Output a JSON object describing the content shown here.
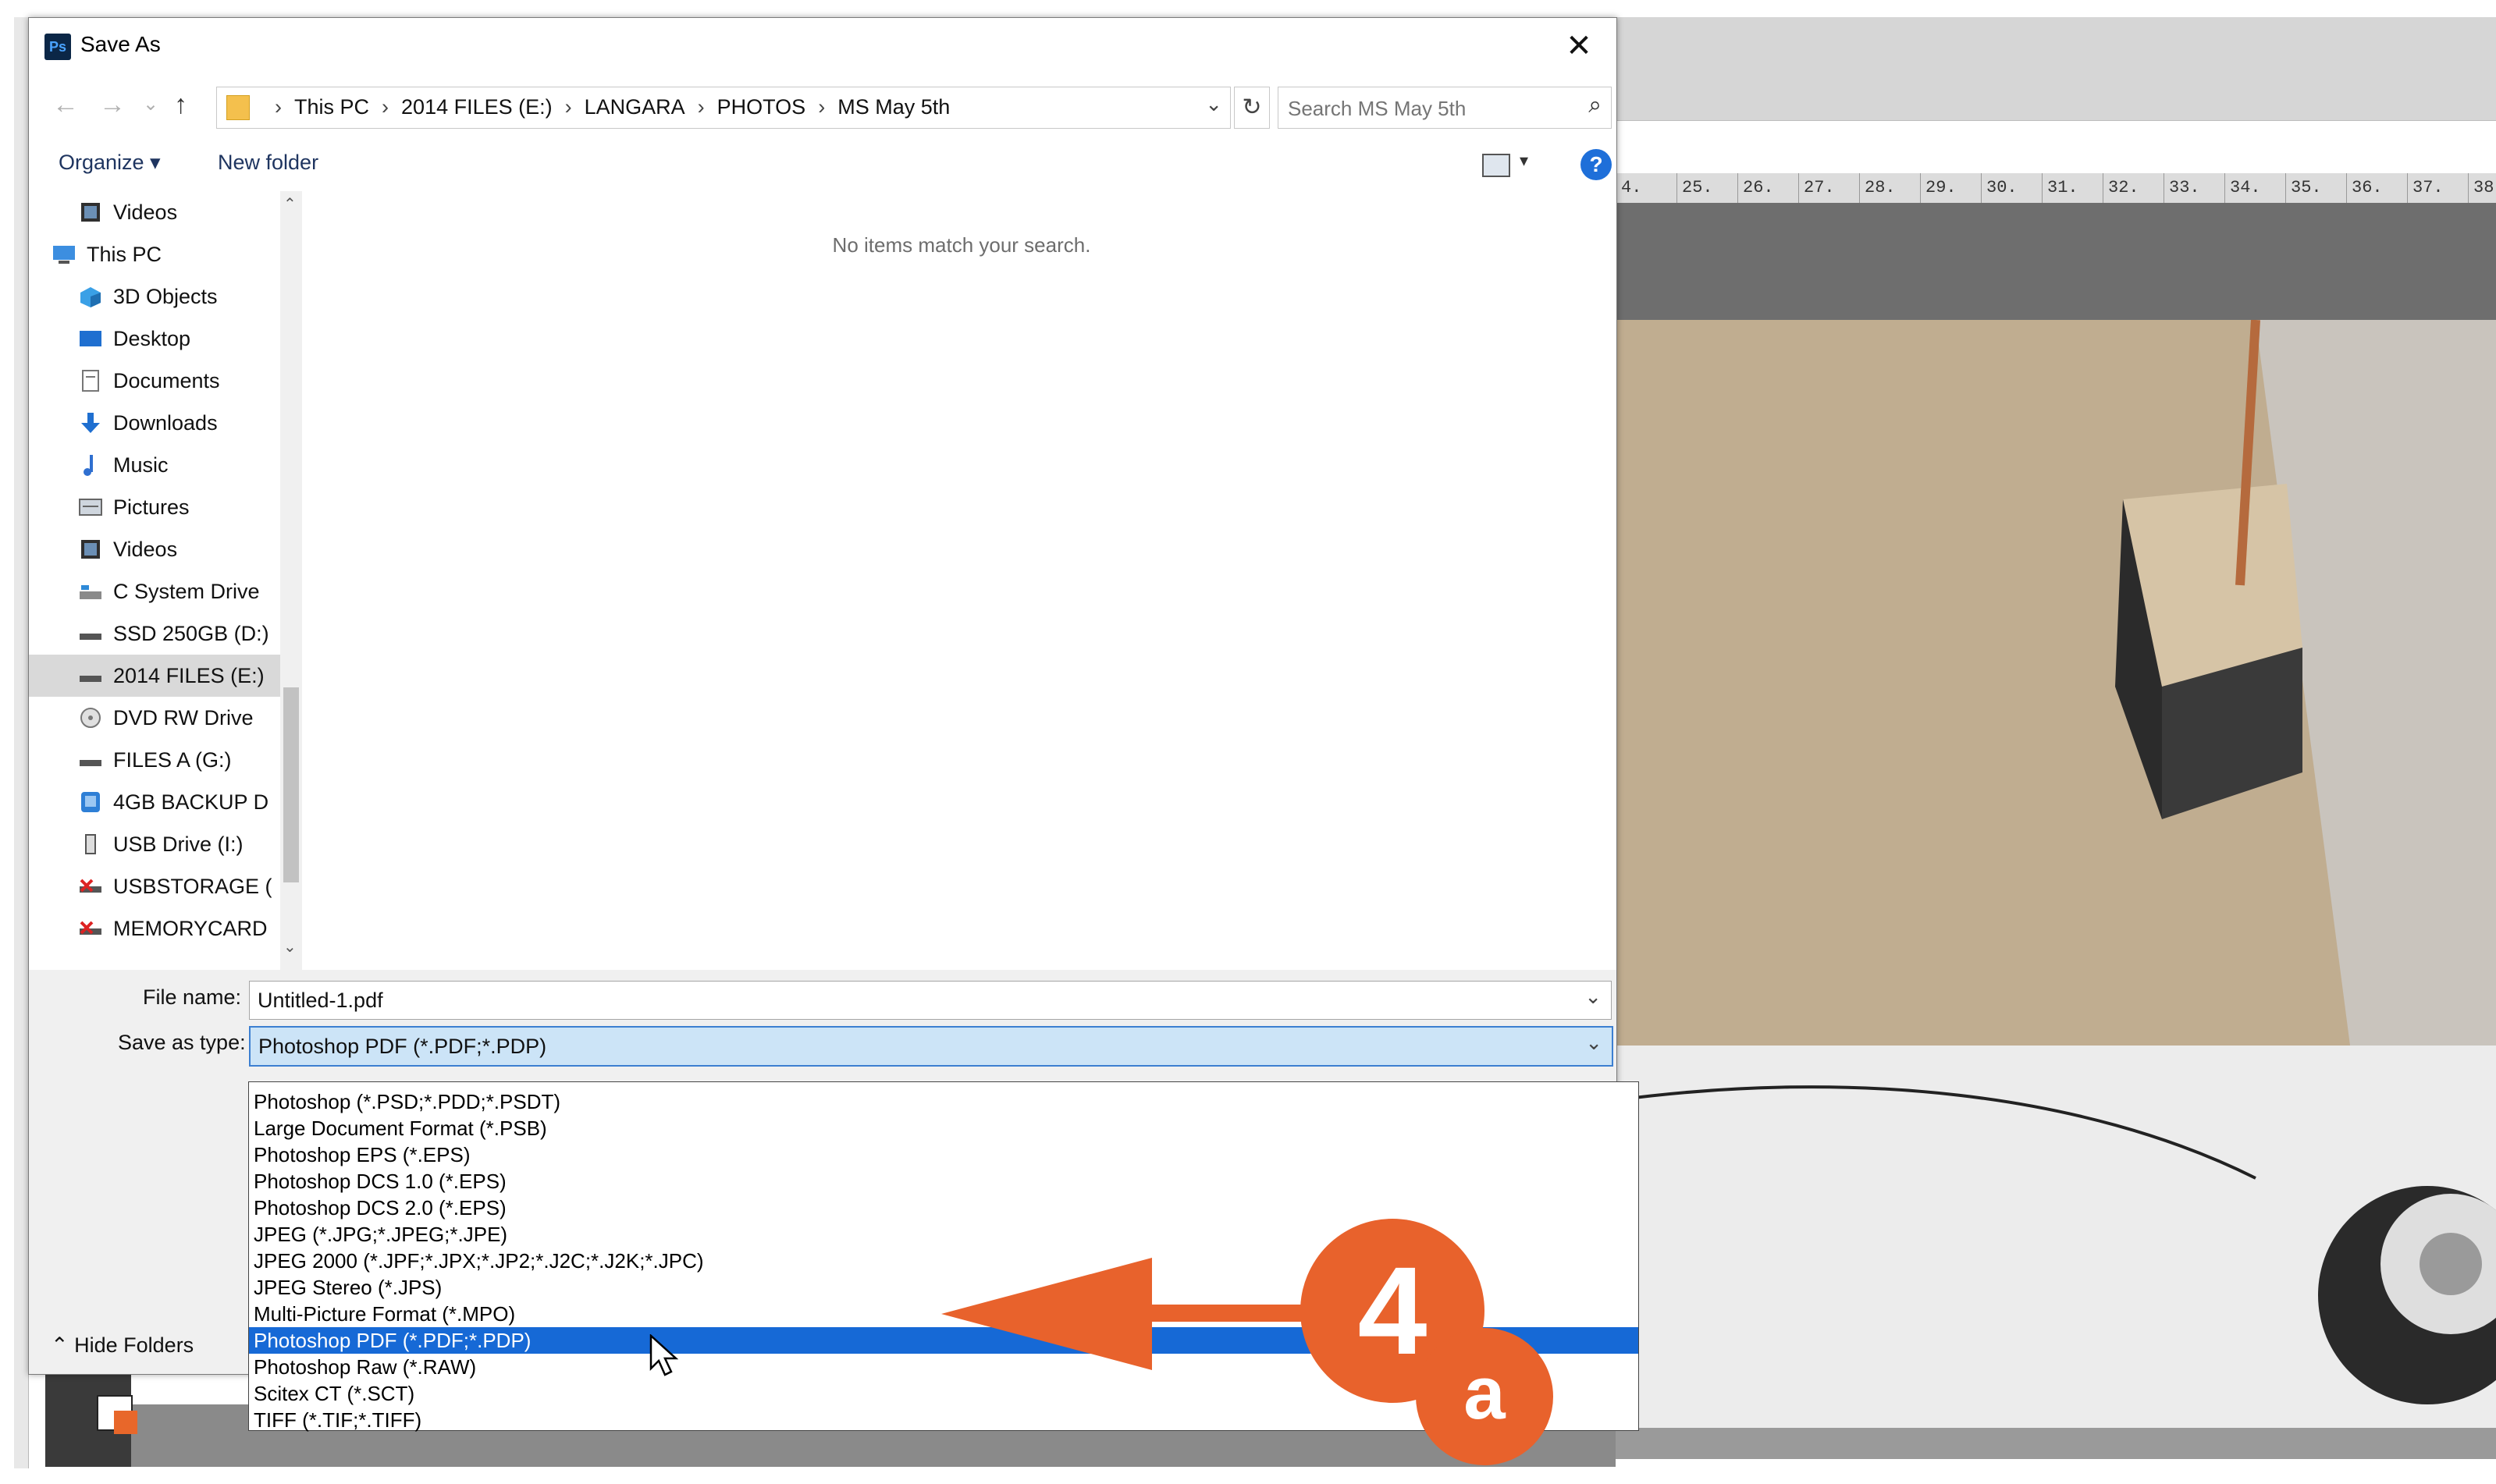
{
  "dialog": {
    "title": "Save As",
    "app_icon": "Ps",
    "close_glyph": "✕"
  },
  "nav": {
    "back_glyph": "←",
    "forward_glyph": "→",
    "recent_glyph": "⌄",
    "up_glyph": "↑",
    "breadcrumbs": [
      "This PC",
      "2014 FILES (E:)",
      "LANGARA",
      "PHOTOS",
      "MS May 5th"
    ],
    "separator": "›",
    "dropdown_glyph": "⌄",
    "refresh_glyph": "↻",
    "search_placeholder": "Search MS May 5th",
    "search_glyph": "⌕"
  },
  "commands": {
    "organize": "Organize ▾",
    "new_folder": "New folder",
    "view_dropdown": "▾",
    "help": "?"
  },
  "navpane": {
    "scroll_up": "⌃",
    "scroll_down": "⌄",
    "items": [
      {
        "label": "Videos",
        "icon": "video-icon"
      },
      {
        "label": "This PC",
        "icon": "computer-icon"
      },
      {
        "label": "3D Objects",
        "icon": "cube-icon"
      },
      {
        "label": "Desktop",
        "icon": "desktop-icon"
      },
      {
        "label": "Documents",
        "icon": "document-icon"
      },
      {
        "label": "Downloads",
        "icon": "download-icon"
      },
      {
        "label": "Music",
        "icon": "music-icon"
      },
      {
        "label": "Pictures",
        "icon": "picture-icon"
      },
      {
        "label": "Videos",
        "icon": "video-icon"
      },
      {
        "label": "C System Drive",
        "icon": "system-drive-icon"
      },
      {
        "label": "SSD 250GB (D:)",
        "icon": "drive-icon"
      },
      {
        "label": "2014 FILES (E:)",
        "icon": "drive-icon",
        "selected": true
      },
      {
        "label": "DVD RW Drive",
        "icon": "dvd-icon"
      },
      {
        "label": "FILES A (G:)",
        "icon": "drive-icon"
      },
      {
        "label": "4GB BACKUP D",
        "icon": "backup-drive-icon"
      },
      {
        "label": "USB Drive (I:)",
        "icon": "usb-icon"
      },
      {
        "label": "USBSTORAGE (",
        "icon": "removable-icon"
      },
      {
        "label": "MEMORYCARD",
        "icon": "removable-icon"
      }
    ]
  },
  "filepane": {
    "empty_message": "No items match your search."
  },
  "form": {
    "file_name_label": "File name:",
    "file_name_value": "Untitled-1.pdf",
    "save_type_label": "Save as type:",
    "save_type_value": "Photoshop PDF (*.PDF;*.PDP)",
    "chevron": "⌄",
    "hide_folders": "⌃ Hide Folders"
  },
  "dropdown": {
    "options": [
      "Photoshop (*.PSD;*.PDD;*.PSDT)",
      "Large Document Format (*.PSB)",
      "Photoshop EPS (*.EPS)",
      "Photoshop DCS 1.0 (*.EPS)",
      "Photoshop DCS 2.0 (*.EPS)",
      "JPEG (*.JPG;*.JPEG;*.JPE)",
      "JPEG 2000 (*.JPF;*.JPX;*.JP2;*.J2C;*.J2K;*.JPC)",
      "JPEG Stereo (*.JPS)",
      "Multi-Picture Format (*.MPO)",
      "Photoshop PDF (*.PDF;*.PDP)",
      "Photoshop Raw (*.RAW)",
      "Scitex CT (*.SCT)",
      "TIFF (*.TIF;*.TIFF)"
    ],
    "selected_index": 9
  },
  "annotation": {
    "step_number": "4",
    "step_letter": "a",
    "color": "#e8622c"
  },
  "ruler": {
    "ticks": [
      "4.",
      "25.",
      "26.",
      "27.",
      "28.",
      "29.",
      "30.",
      "31.",
      "32.",
      "33.",
      "34.",
      "35.",
      "36.",
      "37.",
      "38."
    ]
  },
  "colors": {
    "accent": "#1669d6",
    "selected_field": "#cce4f7"
  }
}
